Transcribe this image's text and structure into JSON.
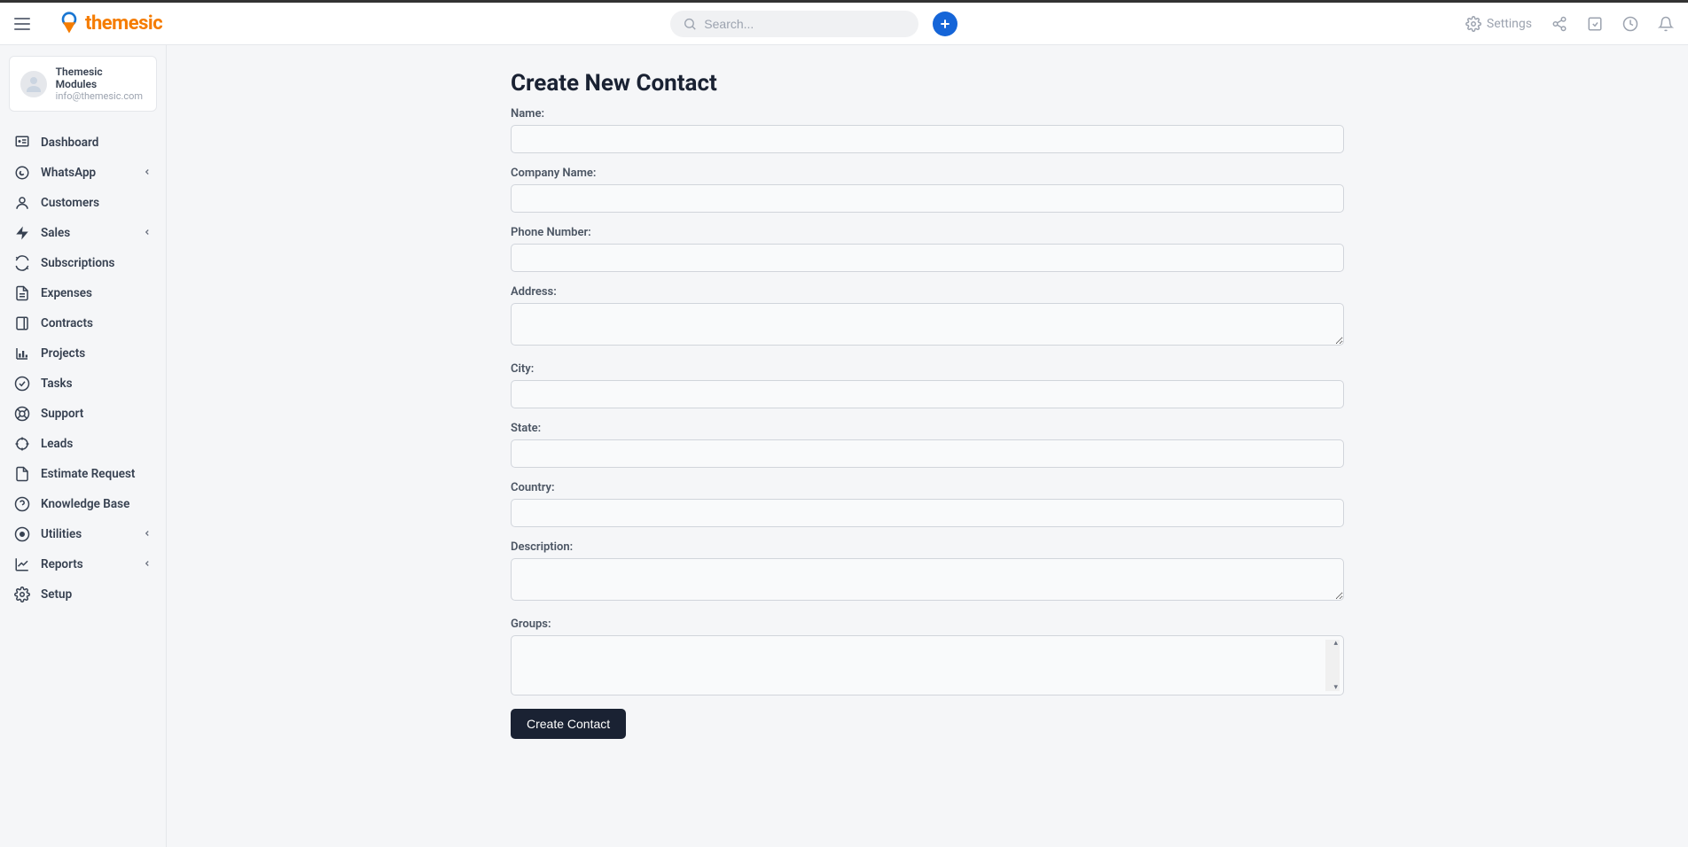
{
  "header": {
    "brand": "themesic",
    "search_placeholder": "Search...",
    "settings_label": "Settings"
  },
  "user": {
    "name": "Themesic Modules",
    "email": "info@themesic.com"
  },
  "sidebar": {
    "items": [
      {
        "label": "Dashboard",
        "icon": "dashboard",
        "expandable": false
      },
      {
        "label": "WhatsApp",
        "icon": "whatsapp",
        "expandable": true
      },
      {
        "label": "Customers",
        "icon": "user",
        "expandable": false
      },
      {
        "label": "Sales",
        "icon": "bolt",
        "expandable": true
      },
      {
        "label": "Subscriptions",
        "icon": "refresh",
        "expandable": false
      },
      {
        "label": "Expenses",
        "icon": "file",
        "expandable": false
      },
      {
        "label": "Contracts",
        "icon": "doc",
        "expandable": false
      },
      {
        "label": "Projects",
        "icon": "chart",
        "expandable": false
      },
      {
        "label": "Tasks",
        "icon": "check",
        "expandable": false
      },
      {
        "label": "Support",
        "icon": "help",
        "expandable": false
      },
      {
        "label": "Leads",
        "icon": "target",
        "expandable": false
      },
      {
        "label": "Estimate Request",
        "icon": "estimate",
        "expandable": false
      },
      {
        "label": "Knowledge Base",
        "icon": "question",
        "expandable": false
      },
      {
        "label": "Utilities",
        "icon": "record",
        "expandable": true
      },
      {
        "label": "Reports",
        "icon": "report",
        "expandable": true
      },
      {
        "label": "Setup",
        "icon": "gear",
        "expandable": false
      }
    ]
  },
  "page": {
    "title": "Create New Contact",
    "fields": [
      {
        "label": "Name:",
        "type": "text"
      },
      {
        "label": "Company Name:",
        "type": "text"
      },
      {
        "label": "Phone Number:",
        "type": "text"
      },
      {
        "label": "Address:",
        "type": "textarea"
      },
      {
        "label": "City:",
        "type": "text"
      },
      {
        "label": "State:",
        "type": "text"
      },
      {
        "label": "Country:",
        "type": "text"
      },
      {
        "label": "Description:",
        "type": "textarea"
      },
      {
        "label": "Groups:",
        "type": "multiselect"
      }
    ],
    "submit_label": "Create Contact"
  }
}
